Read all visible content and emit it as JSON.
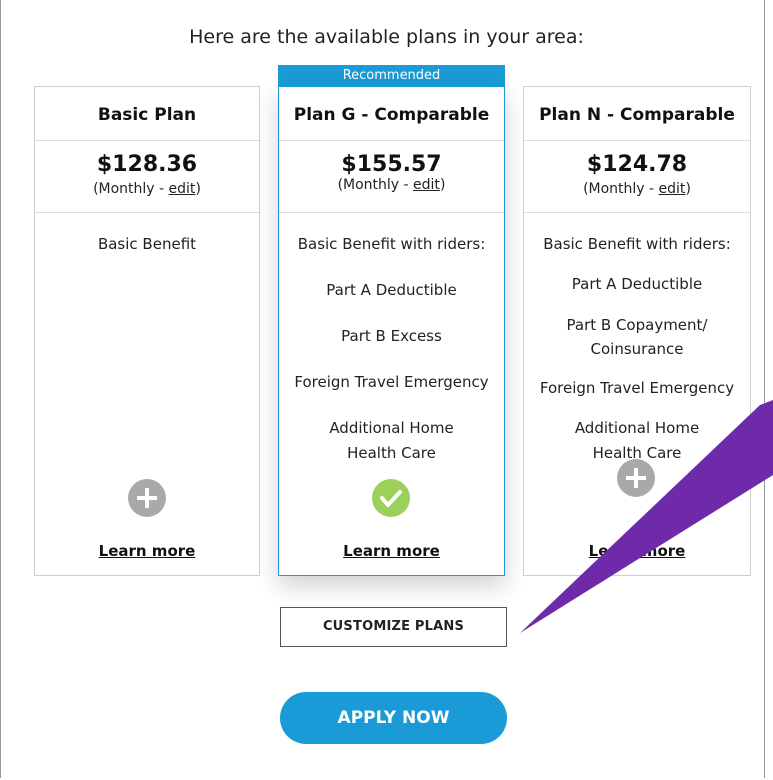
{
  "heading": "Here are the available plans in your area:",
  "recommended_label": "Recommended",
  "plans": [
    {
      "name": "Basic Plan",
      "price": "$128.36",
      "freq_prefix": "(Monthly - ",
      "freq_link": "edit",
      "freq_suffix": ")",
      "benefits": [
        "Basic Benefit"
      ],
      "icon": "plus-icon",
      "learn_more": "Learn more"
    },
    {
      "name": "Plan G - Comparable",
      "price": "$155.57",
      "freq_prefix": "(Monthly - ",
      "freq_link": "edit",
      "freq_suffix": ")",
      "benefits": [
        "Basic Benefit with riders:",
        "Part A Deductible",
        "Part B Excess",
        "Foreign Travel Emergency",
        "Additional Home",
        "Health Care"
      ],
      "icon": "check-icon",
      "learn_more": "Learn more"
    },
    {
      "name": "Plan N - Comparable",
      "price": "$124.78",
      "freq_prefix": "(Monthly - ",
      "freq_link": "edit",
      "freq_suffix": ")",
      "benefits": [
        "Basic Benefit with riders:",
        "Part A Deductible",
        "Part B Copayment/",
        "Coinsurance",
        "Foreign Travel Emergency",
        "Additional Home",
        "Health Care"
      ],
      "icon": "plus-icon",
      "learn_more": "Learn more"
    }
  ],
  "customize_label": "CUSTOMIZE PLANS",
  "apply_label": "APPLY NOW",
  "colors": {
    "accent": "#1a9ad6",
    "check": "#9bd05a",
    "plus": "#a9a9a9",
    "arrow": "#6e2aa8"
  }
}
